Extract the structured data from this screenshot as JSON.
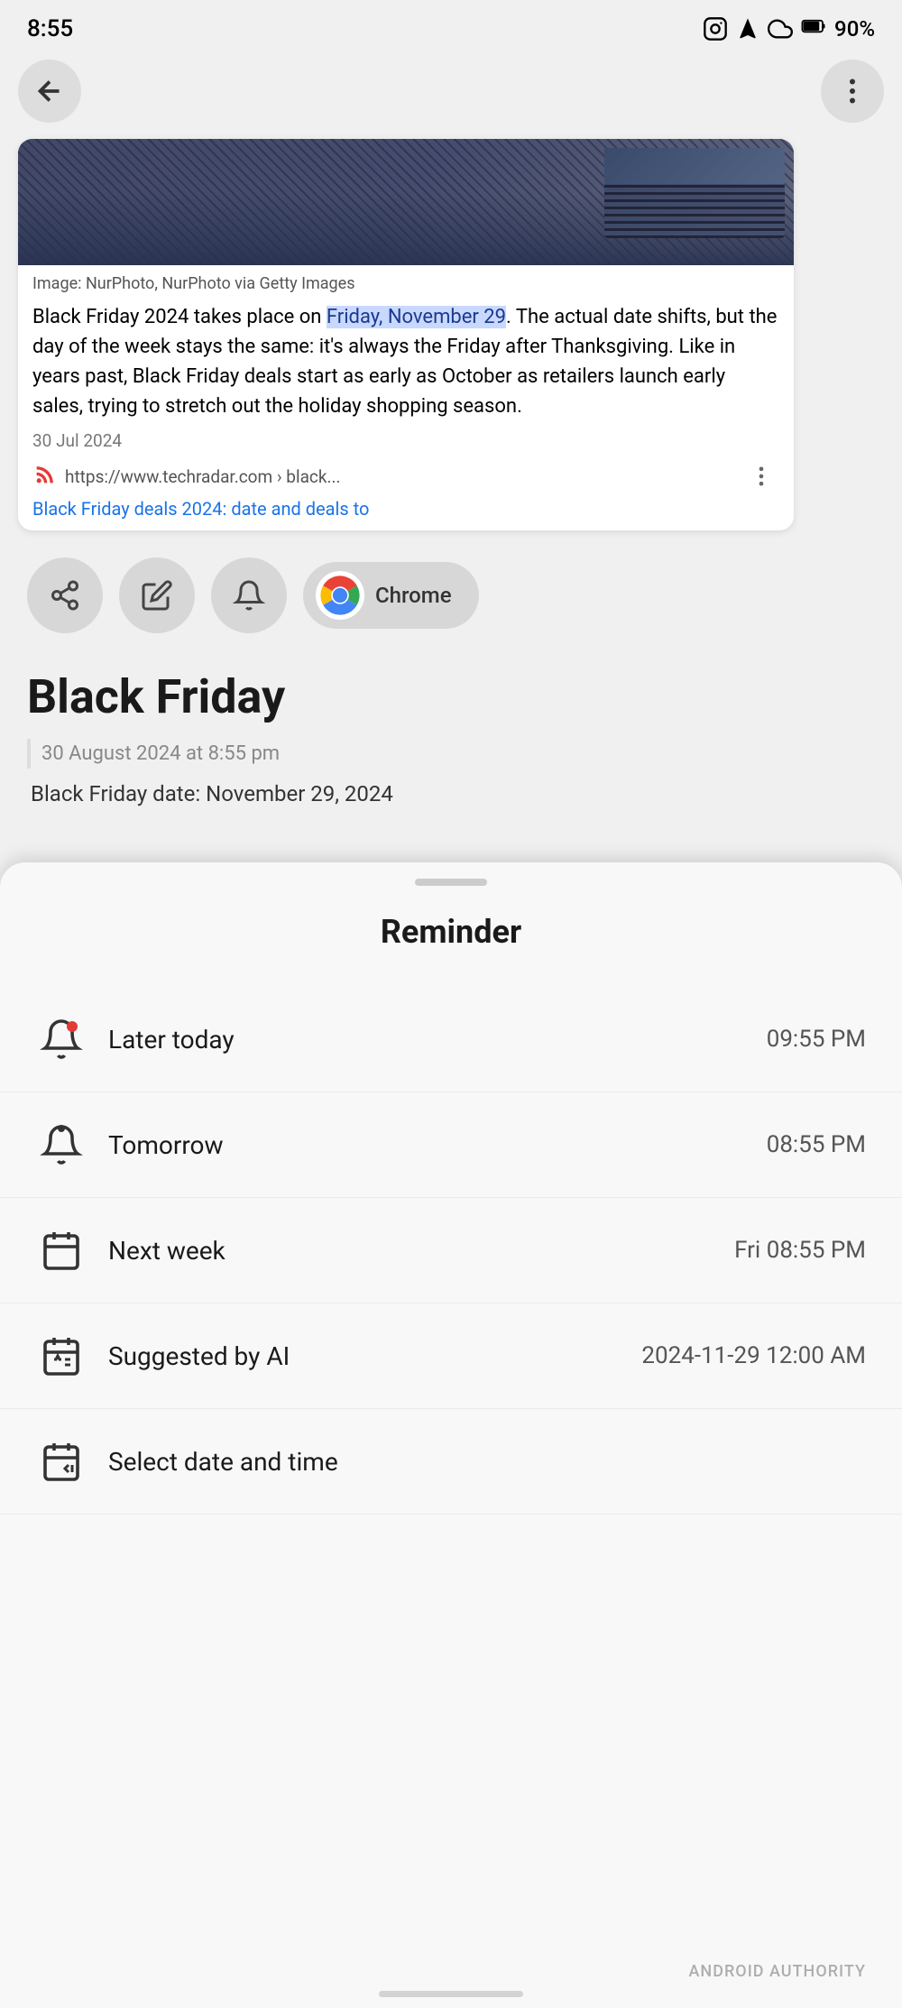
{
  "statusBar": {
    "time": "8:55",
    "battery": "90%"
  },
  "articleCard": {
    "imageCaption": "Image: NurPhoto, NurPhoto via Getty Images",
    "bodyText1": "Black Friday 2024 takes place on ",
    "bodyTextHighlight": "Friday, November 29",
    "bodyText2": ". The actual date shifts, but the day of the week stays the same: it's always the Friday after Thanksgiving. Like in years past, Black Friday deals start as early as October as retailers launch early sales, trying to stretch out the holiday shopping season.",
    "articleDate": "30 Jul 2024",
    "sourceUrl": "https://www.techradar.com › black...",
    "articleLink": "Black Friday deals 2024: date and deals to"
  },
  "chromButton": {
    "label": "Chrome"
  },
  "noteSection": {
    "title": "Black Friday",
    "timestamp": "30 August 2024 at 8:55 pm",
    "contentPreview": "Black Friday date: November 29, 2024"
  },
  "bottomSheet": {
    "title": "Reminder",
    "items": [
      {
        "label": "Later today",
        "time": "09:55 PM",
        "iconType": "bell-outline"
      },
      {
        "label": "Tomorrow",
        "time": "08:55 PM",
        "iconType": "bell-filled"
      },
      {
        "label": "Next week",
        "time": "Fri 08:55 PM",
        "iconType": "calendar"
      },
      {
        "label": "Suggested by AI",
        "time": "2024-11-29 12:00 AM",
        "iconType": "calendar-ai"
      },
      {
        "label": "Select date and time",
        "time": "",
        "iconType": "calendar-edit"
      }
    ]
  },
  "watermark": "ANDROID AUTHORITY"
}
